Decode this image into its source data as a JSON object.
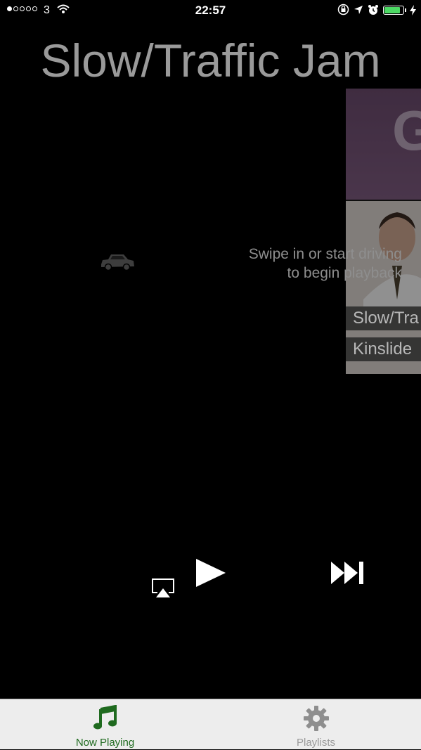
{
  "status_bar": {
    "carrier": "3",
    "time": "22:57",
    "battery_level": 0.85,
    "colors": {
      "battery": "#4cd964"
    }
  },
  "now_playing": {
    "title": "Slow/Traffic Jam",
    "hint": [
      "Swipe in or start driving",
      "to begin playback"
    ]
  },
  "carousel": {
    "labels": [
      "Slow/Tra",
      "Kinslide"
    ],
    "cover_letter": "G"
  },
  "controls": {
    "airplay_icon": "airplay-icon",
    "play_icon": "play-icon",
    "next_icon": "skip-forward-icon"
  },
  "tab_bar": {
    "tabs": [
      {
        "label": "Now Playing",
        "icon": "music-note-icon",
        "selected": true,
        "color": "#1f6a1f"
      },
      {
        "label": "Playlists",
        "icon": "gear-icon",
        "selected": false,
        "color": "#9a9a9a"
      }
    ]
  }
}
